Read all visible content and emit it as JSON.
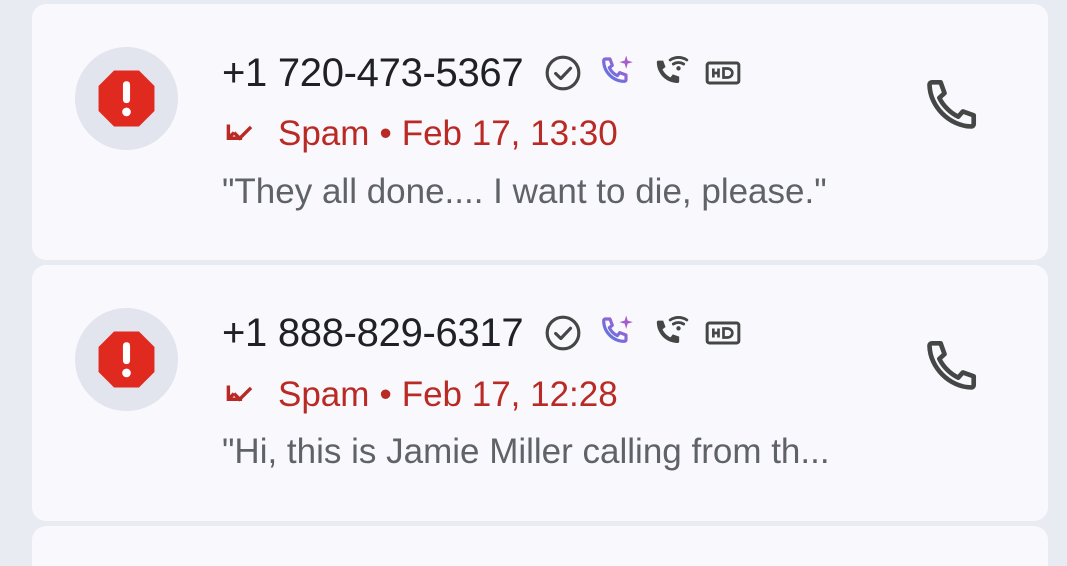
{
  "calls": [
    {
      "number": "+1 720-473-5367",
      "status": "Spam",
      "separator": "•",
      "time": "Feb 17, 13:30",
      "snippet": "\"They all done.... I want to die, please.\"",
      "icons": [
        "verified-check-icon",
        "ai-call-icon",
        "wifi-calling-icon",
        "hd-voice-icon",
        "missed-call-icon",
        "spam-warning-icon",
        "call-back-icon"
      ]
    },
    {
      "number": "+1 888-829-6317",
      "status": "Spam",
      "separator": "•",
      "time": "Feb 17, 12:28",
      "snippet": "\"Hi, this is Jamie Miller calling from th...",
      "icons": [
        "verified-check-icon",
        "ai-call-icon",
        "wifi-calling-icon",
        "hd-voice-icon",
        "missed-call-icon",
        "spam-warning-icon",
        "call-back-icon"
      ]
    }
  ],
  "colors": {
    "background": "#e9ebf3",
    "card": "#f8f8fd",
    "spam_red": "#ba2a25",
    "warning_red": "#e0291f",
    "text_primary": "#202124",
    "text_secondary": "#5f6368",
    "icon_gray": "#444746"
  }
}
